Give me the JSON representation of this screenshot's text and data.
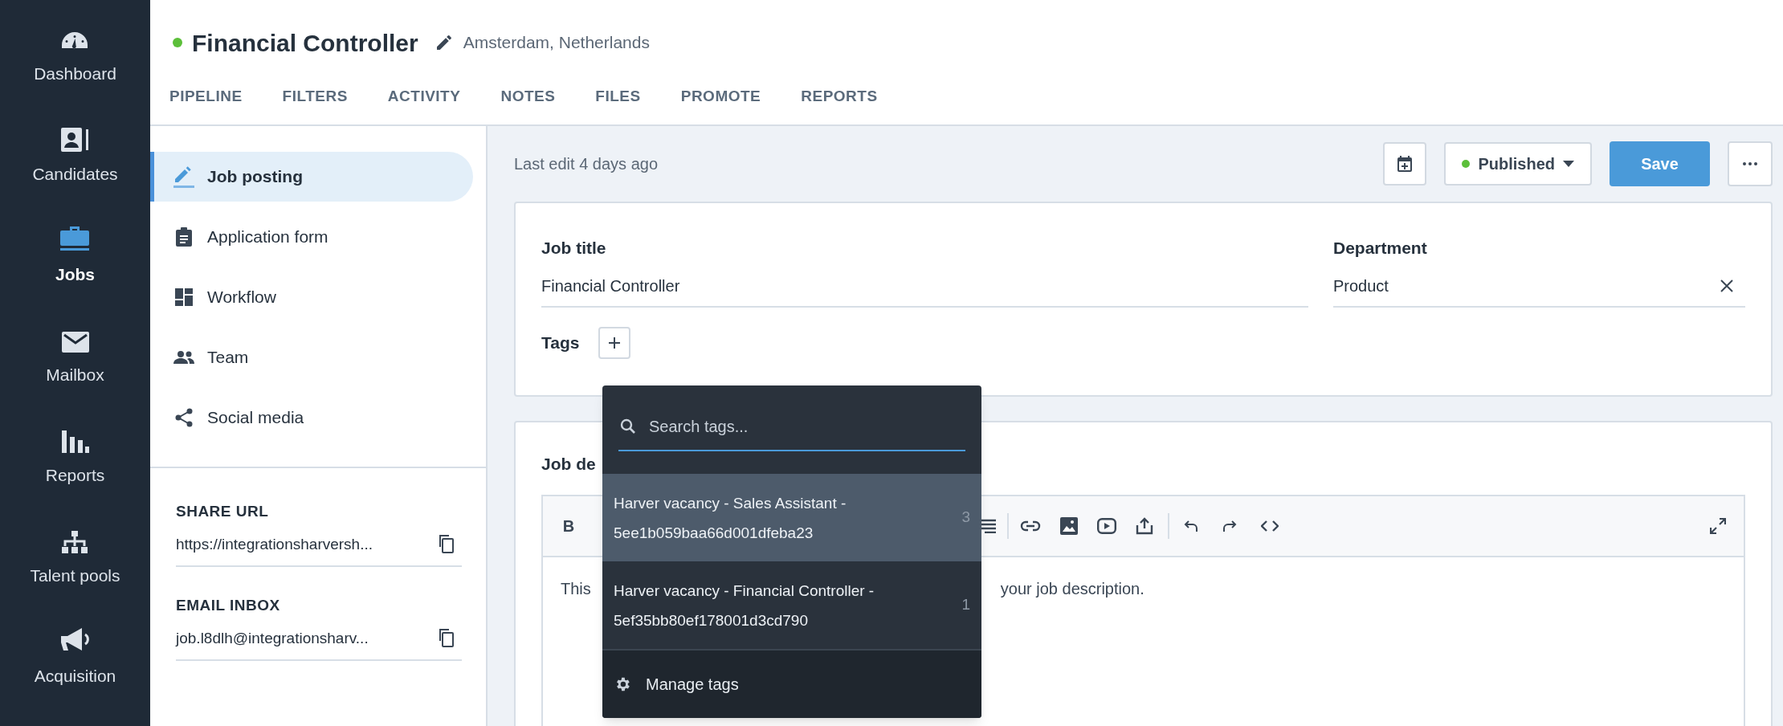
{
  "sidebar": {
    "items": [
      {
        "label": "Dashboard",
        "selected": false
      },
      {
        "label": "Candidates",
        "selected": false
      },
      {
        "label": "Jobs",
        "selected": true
      },
      {
        "label": "Mailbox",
        "selected": false
      },
      {
        "label": "Reports",
        "selected": false
      },
      {
        "label": "Talent pools",
        "selected": false
      },
      {
        "label": "Acquisition",
        "selected": false
      }
    ]
  },
  "job": {
    "title": "Financial Controller",
    "location": "Amsterdam, Netherlands"
  },
  "tabs": [
    {
      "label": "PIPELINE",
      "selected": false
    },
    {
      "label": "FILTERS",
      "selected": false
    },
    {
      "label": "ACTIVITY",
      "selected": false
    },
    {
      "label": "NOTES",
      "selected": false
    },
    {
      "label": "FILES",
      "selected": false
    },
    {
      "label": "PROMOTE",
      "selected": false
    },
    {
      "label": "REPORTS",
      "selected": false
    }
  ],
  "side_menu": [
    {
      "label": "Job posting",
      "selected": true
    },
    {
      "label": "Application form",
      "selected": false
    },
    {
      "label": "Workflow",
      "selected": false
    },
    {
      "label": "Team",
      "selected": false
    },
    {
      "label": "Social media",
      "selected": false
    }
  ],
  "share_url": {
    "label": "SHARE URL",
    "value": "https://integrationsharversh..."
  },
  "email_inbox": {
    "label": "EMAIL INBOX",
    "value": "job.l8dlh@integrationsharv..."
  },
  "toolbar": {
    "last_edit": "Last edit 4 days ago",
    "status": "Published",
    "save": "Save"
  },
  "job_form": {
    "title_label": "Job title",
    "title_value": "Financial Controller",
    "department_label": "Department",
    "department_value": "Product",
    "tags_label": "Tags"
  },
  "job_description": {
    "label": "Job de",
    "bold_button": "B",
    "text_parts": [
      "This",
      "your job description."
    ]
  },
  "tag_dropdown": {
    "placeholder": "Search tags...",
    "items": [
      {
        "label": "Harver vacancy - Sales Assistant - 5ee1b059baa66d001dfeba23",
        "count": "3",
        "selected": true
      },
      {
        "label": "Harver vacancy - Financial Controller - 5ef35bb80ef178001d3cd790",
        "count": "1",
        "selected": false
      }
    ],
    "manage": "Manage tags"
  }
}
